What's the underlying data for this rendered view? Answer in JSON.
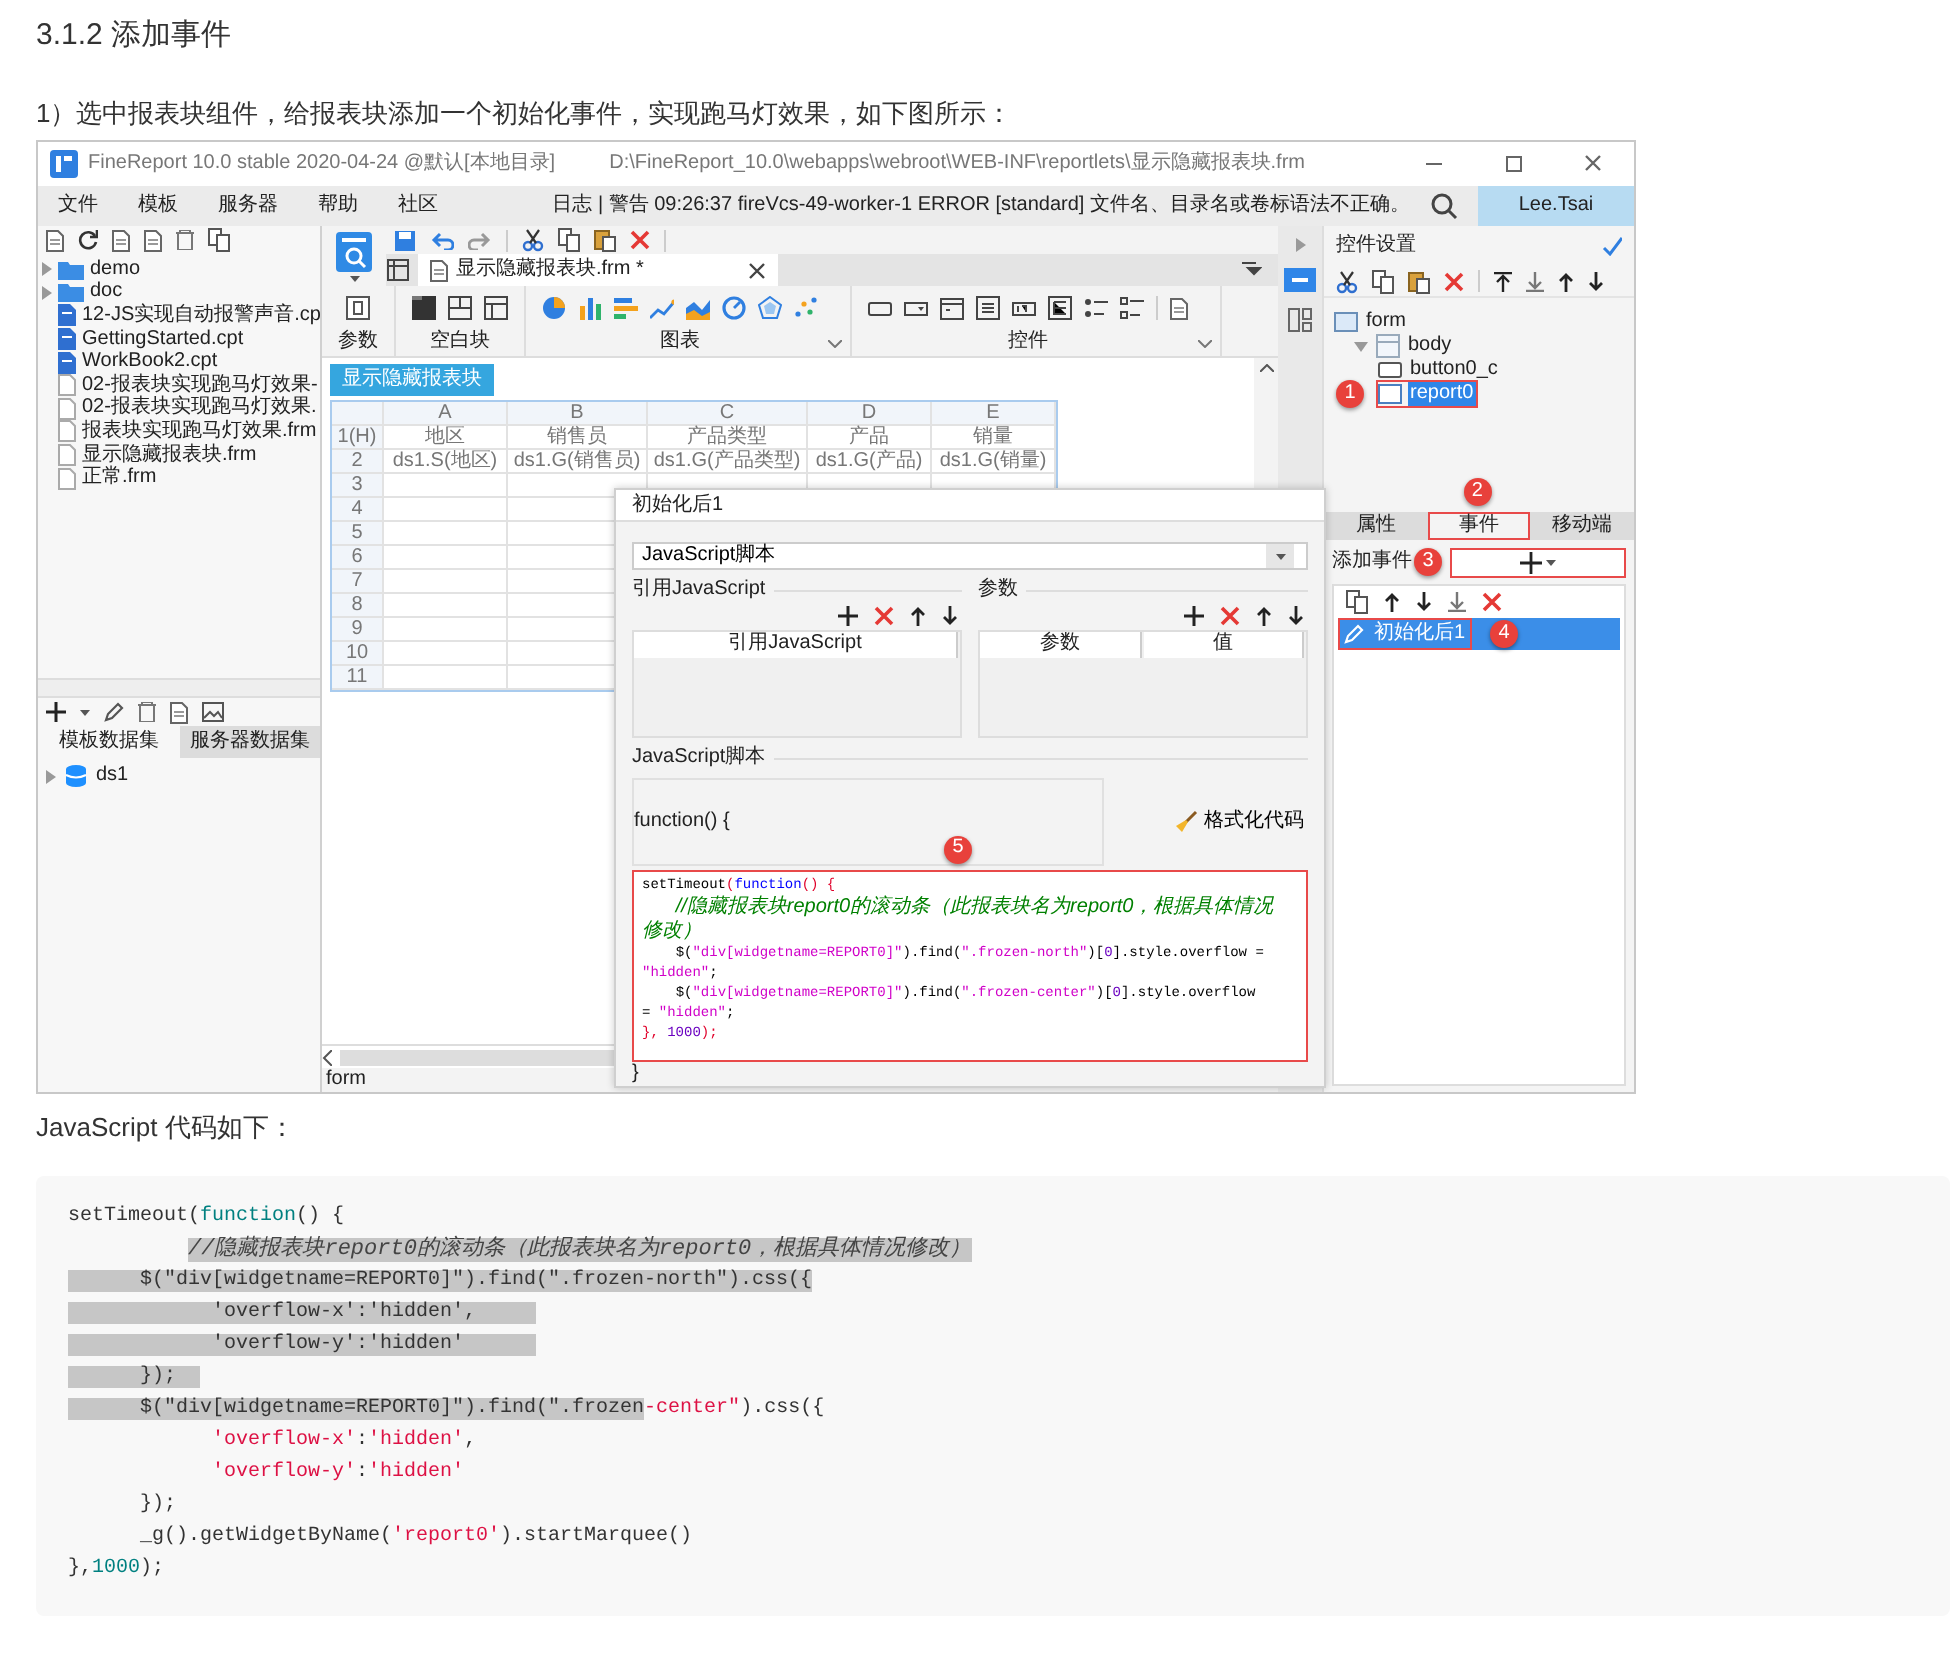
{
  "heading": "3.1.2 添加事件",
  "intro": "1）选中报表块组件，给报表块添加一个初始化事件，实现跑马灯效果，如下图所示：",
  "app": {
    "title": "FineReport 10.0 stable 2020-04-24 @默认[本地目录]",
    "path": "D:\\FineReport_10.0\\webapps\\webroot\\WEB-INF\\reportlets\\显示隐藏报表块.frm",
    "menu": [
      "文件",
      "模板",
      "服务器",
      "帮助",
      "社区"
    ],
    "log": "日志 | 警告 09:26:37 fireVcs-49-worker-1 ERROR [standard] 文件名、目录名或卷标语法不正确。",
    "user": "Lee.Tsai",
    "files": [
      {
        "name": "demo",
        "kind": "folder"
      },
      {
        "name": "doc",
        "kind": "folder"
      },
      {
        "name": "12-JS实现自动报警声音.cp",
        "kind": "cpt"
      },
      {
        "name": "GettingStarted.cpt",
        "kind": "cpt"
      },
      {
        "name": "WorkBook2.cpt",
        "kind": "cpt"
      },
      {
        "name": "02-报表块实现跑马灯效果-",
        "kind": "frm"
      },
      {
        "name": "02-报表块实现跑马灯效果.",
        "kind": "frm"
      },
      {
        "name": "报表块实现跑马灯效果.frm",
        "kind": "frm"
      },
      {
        "name": "显示隐藏报表块.frm",
        "kind": "frm"
      },
      {
        "name": "正常.frm",
        "kind": "frm"
      }
    ],
    "dataset_tabs": [
      {
        "label": "模板数据集",
        "selected": true
      },
      {
        "label": "服务器数据集",
        "selected": false
      }
    ],
    "datasets": [
      "ds1"
    ],
    "doc_tab": "显示隐藏报表块.frm *",
    "ribbon": [
      {
        "label": "参数",
        "kind": "param"
      },
      {
        "label": "空白块",
        "kind": "blank"
      },
      {
        "label": "图表",
        "kind": "chart"
      },
      {
        "label": "控件",
        "kind": "widget"
      }
    ],
    "canvas_button": "显示隐藏报表块",
    "sheet": {
      "columns": [
        "A",
        "B",
        "C",
        "D",
        "E"
      ],
      "rows": [
        {
          "header": "1(H)",
          "cells": [
            "地区",
            "销售员",
            "产品类型",
            "产品",
            "销量"
          ]
        },
        {
          "header": "2",
          "cells": [
            "ds1.S(地区)",
            "ds1.G(销售员)",
            "ds1.G(产品类型)",
            "ds1.G(产品)",
            "ds1.G(销量)"
          ]
        },
        {
          "header": "3"
        },
        {
          "header": "4"
        },
        {
          "header": "5"
        },
        {
          "header": "6"
        },
        {
          "header": "7"
        },
        {
          "header": "8"
        },
        {
          "header": "9"
        },
        {
          "header": "10"
        },
        {
          "header": "11"
        }
      ]
    },
    "status": "form",
    "dialog": {
      "title": "初始化后1",
      "type": "JavaScript脚本",
      "ref_title": "引用JavaScript",
      "ref_columns": [
        "引用JavaScript"
      ],
      "param_title": "参数",
      "param_columns": [
        "参数",
        "值"
      ],
      "script_title": "JavaScript脚本",
      "fn_open": "function() {",
      "format": "格式化代码",
      "marker": "5",
      "code": [
        {
          "segments": [
            {
              "text": "setTimeout",
              "kind": "plain"
            },
            {
              "text": "(",
              "kind": "punct"
            },
            {
              "text": "function",
              "kind": "keyword"
            },
            {
              "text": "() {",
              "kind": "punct"
            }
          ]
        },
        {
          "segments": [
            {
              "text": "    //隐藏报表块report0的滚动条（此报表块名为report0，根据具体情况修改）",
              "kind": "comment"
            }
          ]
        },
        {
          "segments": [
            {
              "text": "    $(",
              "kind": "plain"
            },
            {
              "text": "\"div[widgetname=REPORT0]\"",
              "kind": "string"
            },
            {
              "text": ").find(",
              "kind": "plain"
            },
            {
              "text": "\".frozen-north\"",
              "kind": "string"
            },
            {
              "text": ")[",
              "kind": "plain"
            },
            {
              "text": "0",
              "kind": "number"
            },
            {
              "text": "].style.overflow =",
              "kind": "plain"
            }
          ]
        },
        {
          "segments": [
            {
              "text": "\"hidden\"",
              "kind": "string"
            },
            {
              "text": ";",
              "kind": "plain"
            }
          ]
        },
        {
          "segments": [
            {
              "text": "    $(",
              "kind": "plain"
            },
            {
              "text": "\"div[widgetname=REPORT0]\"",
              "kind": "string"
            },
            {
              "text": ").find(",
              "kind": "plain"
            },
            {
              "text": "\".frozen-center\"",
              "kind": "string"
            },
            {
              "text": ")[",
              "kind": "plain"
            },
            {
              "text": "0",
              "kind": "number"
            },
            {
              "text": "].style.overflow",
              "kind": "plain"
            }
          ]
        },
        {
          "segments": [
            {
              "text": "= ",
              "kind": "plain"
            },
            {
              "text": "\"hidden\"",
              "kind": "string"
            },
            {
              "text": ";",
              "kind": "plain"
            }
          ]
        },
        {
          "segments": [
            {
              "text": "}, ",
              "kind": "punct"
            },
            {
              "text": "1000",
              "kind": "number"
            },
            {
              "text": ");",
              "kind": "punct"
            }
          ]
        }
      ],
      "fn_close": "}"
    },
    "panel": {
      "title": "控件设置",
      "tree": [
        {
          "name": "form",
          "kind": "form",
          "children": [
            {
              "name": "body",
              "kind": "body",
              "expanded": true,
              "children": [
                {
                  "name": "button0_c",
                  "kind": "button",
                  "selected": false,
                  "highlighted": false
                },
                {
                  "name": "report0",
                  "kind": "report",
                  "selected": true,
                  "highlighted": true,
                  "marker": "1"
                }
              ]
            }
          ]
        }
      ],
      "tabs": [
        {
          "label": "属性",
          "selected": false,
          "highlighted": false
        },
        {
          "label": "事件",
          "selected": true,
          "highlighted": true,
          "marker": "2"
        },
        {
          "label": "移动端",
          "selected": false,
          "highlighted": false
        }
      ],
      "add_label": "添加事件",
      "add_marker": "3",
      "events": [
        {
          "label": "初始化后1",
          "selected": true,
          "highlighted": true,
          "marker": "4"
        }
      ]
    }
  },
  "code_label": "JavaScript 代码如下：",
  "code": [
    {
      "segments": [
        {
          "text": "setTimeout(",
          "kind": "plain",
          "selected": false
        },
        {
          "text": "function",
          "kind": "keyword",
          "selected": false
        },
        {
          "text": "() {",
          "kind": "plain",
          "selected": false
        }
      ]
    },
    {
      "segments": [
        {
          "text": "          //隐藏报表块report0的滚动条（此报表块名为report0，根据具体情况修改）",
          "kind": "comment",
          "selected": true
        }
      ]
    },
    {
      "segments": [
        {
          "text": "      $(\"div[widgetname=REPORT0]\").find(\".frozen-north\").css({",
          "kind": "plain",
          "selected": true
        }
      ]
    },
    {
      "segments": [
        {
          "text": "            'overflow-x':'hidden',     ",
          "kind": "plain",
          "selected": true
        }
      ]
    },
    {
      "segments": [
        {
          "text": "            'overflow-y':'hidden'      ",
          "kind": "plain",
          "selected": true
        }
      ]
    },
    {
      "segments": [
        {
          "text": "      });  ",
          "kind": "plain",
          "selected": true
        }
      ]
    },
    {
      "segments": [
        {
          "text": "      $(\"div[widgetname=REPORT0]\").find(\".frozen",
          "kind": "plain",
          "selected": true
        },
        {
          "text": "-center\"",
          "kind": "string",
          "selected": false
        },
        {
          "text": ").css({",
          "kind": "plain",
          "selected": false
        }
      ]
    },
    {
      "segments": [
        {
          "text": "            'overflow-x'",
          "kind": "string",
          "selected": false
        },
        {
          "text": ":",
          "kind": "plain",
          "selected": false
        },
        {
          "text": "'hidden'",
          "kind": "string",
          "selected": false
        },
        {
          "text": ",",
          "kind": "plain",
          "selected": false
        }
      ]
    },
    {
      "segments": [
        {
          "text": "            'overflow-y'",
          "kind": "string",
          "selected": false
        },
        {
          "text": ":",
          "kind": "plain",
          "selected": false
        },
        {
          "text": "'hidden'",
          "kind": "string",
          "selected": false
        }
      ]
    },
    {
      "segments": [
        {
          "text": "      });",
          "kind": "plain",
          "selected": false
        }
      ]
    },
    {
      "segments": [
        {
          "text": "      _g().getWidgetByName(",
          "kind": "plain",
          "selected": false
        },
        {
          "text": "'report0'",
          "kind": "string",
          "selected": false
        },
        {
          "text": ").startMarquee()",
          "kind": "plain",
          "selected": false
        }
      ]
    },
    {
      "segments": [
        {
          "text": "},",
          "kind": "plain",
          "selected": false
        },
        {
          "text": "1000",
          "kind": "number",
          "selected": false
        },
        {
          "text": ");",
          "kind": "plain",
          "selected": false
        }
      ]
    }
  ]
}
